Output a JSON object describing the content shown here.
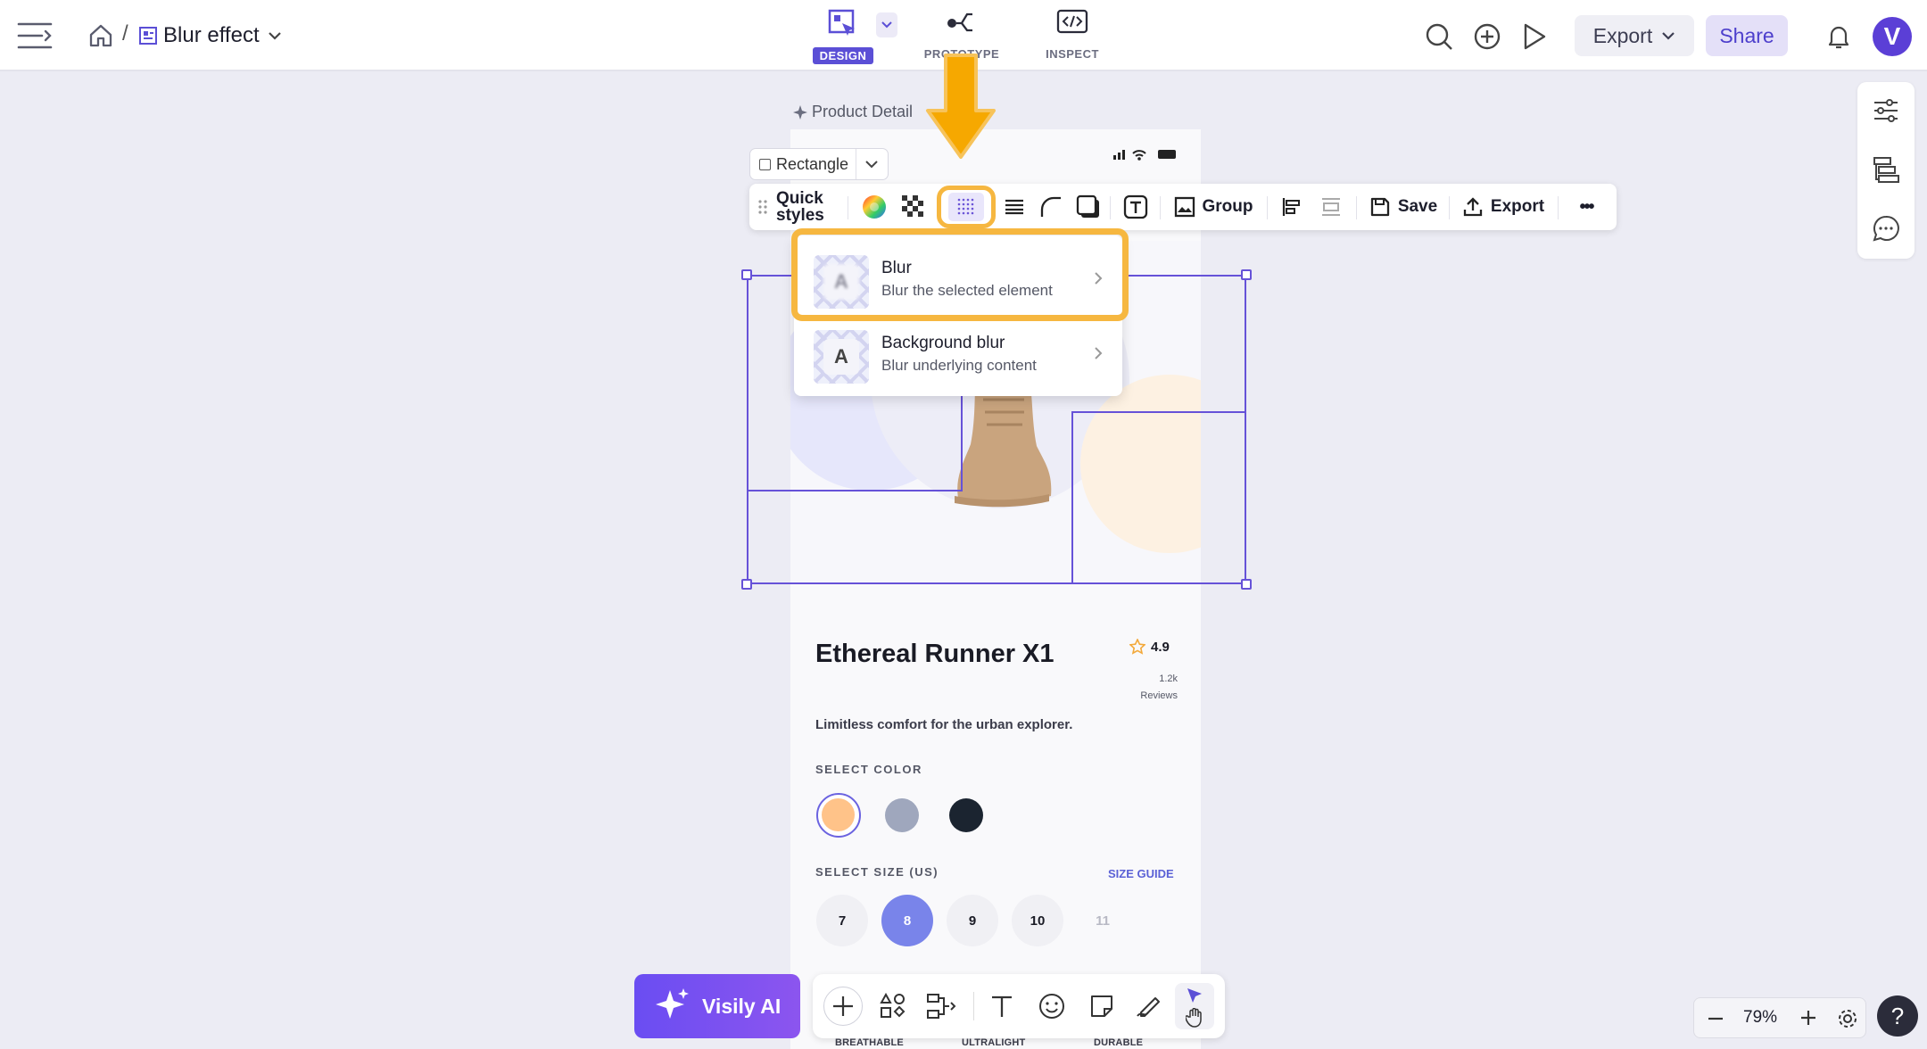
{
  "topbar": {
    "file_name": "Blur effect",
    "breadcrumb_sep": "/",
    "modes": {
      "design": "DESIGN",
      "prototype": "PROTOTYPE",
      "inspect": "INSPECT"
    },
    "export_label": "Export",
    "share_label": "Share",
    "avatar_letter": "V"
  },
  "canvas": {
    "frame_label": "Product Detail",
    "shape_select": "Rectangle"
  },
  "toolbar": {
    "quick_styles": [
      "Quick",
      "styles"
    ],
    "group_label": "Group",
    "save_label": "Save",
    "export_label": "Export",
    "more_label": "•••"
  },
  "blur_menu": {
    "items": [
      {
        "title": "Blur",
        "subtitle": "Blur the selected element",
        "thumb_letter": "A"
      },
      {
        "title": "Background blur",
        "subtitle": "Blur underlying content",
        "thumb_letter": "A"
      }
    ]
  },
  "product": {
    "title": "Ethereal Runner X1",
    "rating": "4.9",
    "reviews_count": "1.2k",
    "reviews_label": "Reviews",
    "description": "Limitless comfort for the urban explorer.",
    "select_color_label": "SELECT COLOR",
    "colors": [
      "#ffc389",
      "#9fa7bd",
      "#1b2430"
    ],
    "select_size_label": "SELECT SIZE (US)",
    "size_guide_label": "SIZE GUIDE",
    "sizes": [
      "7",
      "8",
      "9",
      "10",
      "11"
    ],
    "selected_size": "8",
    "features": [
      "BREATHABLE",
      "ULTRALIGHT",
      "DURABLE"
    ]
  },
  "bottom": {
    "ai_button": "Visily AI",
    "zoom_level": "79%",
    "help": "?"
  },
  "colors": {
    "accent": "#5b4fd6",
    "highlight": "#f6b740",
    "selection": "#6652d8"
  }
}
